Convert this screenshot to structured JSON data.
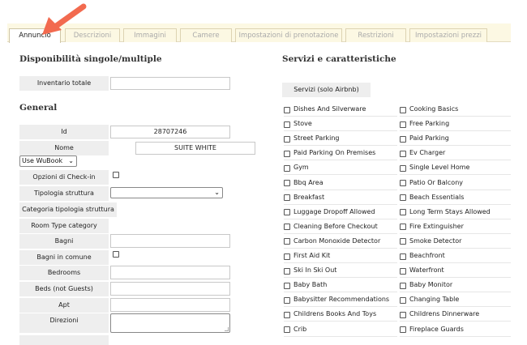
{
  "tabs": [
    {
      "label": "Annuncio",
      "active": true
    },
    {
      "label": "Descrizioni",
      "active": false
    },
    {
      "label": "Immagini",
      "active": false
    },
    {
      "label": "Camere",
      "active": false
    },
    {
      "label": "Impostazioni di prenotazione",
      "active": false
    },
    {
      "label": "Restrizioni",
      "active": false
    },
    {
      "label": "Impostazioni prezzi",
      "active": false
    }
  ],
  "availability": {
    "title": "Disponibilità singole/multiple",
    "inventory_label": "Inventario totale",
    "inventory_value": ""
  },
  "general": {
    "title": "General",
    "id_label": "Id",
    "id_value": "28707246",
    "name_label": "Nome",
    "name_value": "SUITE WHITE",
    "source_select": "Use WuBook",
    "checkin_label": "Opzioni di Check-in",
    "structure_type_label": "Tipologia struttura",
    "structure_category_label": "Categoria tipologia struttura",
    "room_type_label": "Room Type category",
    "bathrooms_label": "Bagni",
    "shared_bathrooms_label": "Bagni in comune",
    "bedrooms_label": "Bedrooms",
    "beds_label": "Beds (not Guests)",
    "apt_label": "Apt",
    "directions_label": "Direzioni"
  },
  "services": {
    "title": "Servizi e caratteristiche",
    "airbnb_button": "Servizi (solo Airbnb)",
    "left": [
      "Dishes And Silverware",
      "Stove",
      "Street Parking",
      "Paid Parking On Premises",
      "Gym",
      "Bbq Area",
      "Breakfast",
      "Luggage Dropoff Allowed",
      "Cleaning Before Checkout",
      "Carbon Monoxide Detector",
      "First Aid Kit",
      "Ski In Ski Out",
      "Baby Bath",
      "Babysitter Recommendations",
      "Childrens Books And Toys",
      "Crib"
    ],
    "right": [
      "Cooking Basics",
      "Free Parking",
      "Paid Parking",
      "Ev Charger",
      "Single Level Home",
      "Patio Or Balcony",
      "Beach Essentials",
      "Long Term Stays Allowed",
      "Fire Extinguisher",
      "Smoke Detector",
      "Beachfront",
      "Waterfront",
      "Baby Monitor",
      "Changing Table",
      "Childrens Dinnerware",
      "Fireplace Guards"
    ]
  },
  "colors": {
    "arrow": "#f26a4f",
    "tab_bg": "#fcf8e3",
    "label_bg": "#eeeeee"
  }
}
